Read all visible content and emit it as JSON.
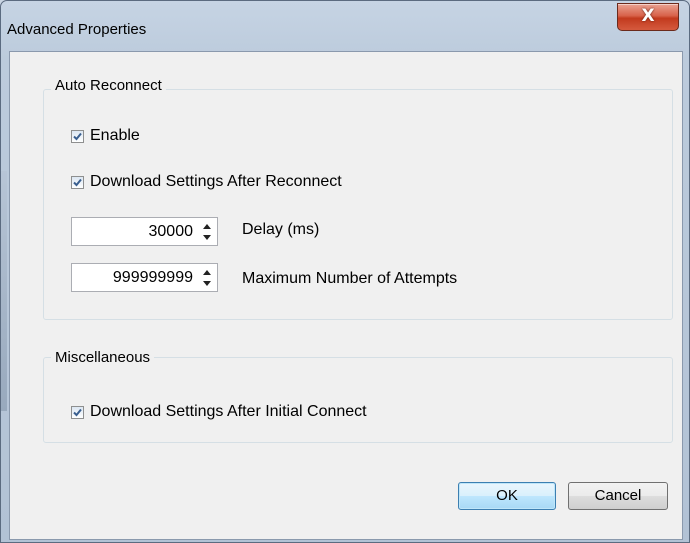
{
  "window": {
    "title": "Advanced Properties",
    "close_glyph": "X"
  },
  "auto_reconnect": {
    "group_label": "Auto Reconnect",
    "enable": {
      "label": "Enable",
      "checked": true
    },
    "download_after_reconnect": {
      "label": "Download Settings After Reconnect",
      "checked": true
    },
    "delay": {
      "value": "30000",
      "label": "Delay (ms)"
    },
    "max_attempts": {
      "value": "999999999",
      "label": "Maximum Number of Attempts"
    }
  },
  "miscellaneous": {
    "group_label": "Miscellaneous",
    "download_after_initial": {
      "label": "Download Settings After Initial Connect",
      "checked": true
    }
  },
  "buttons": {
    "ok": "OK",
    "cancel": "Cancel"
  },
  "icons": {
    "close": "close-icon",
    "check": "checkmark-icon",
    "spin_up": "spin-up-arrow-icon",
    "spin_down": "spin-down-arrow-icon"
  },
  "colors": {
    "close_button": "#c23a1e",
    "checkmark": "#3a5f8f",
    "default_button_border": "#3c7fb1"
  }
}
